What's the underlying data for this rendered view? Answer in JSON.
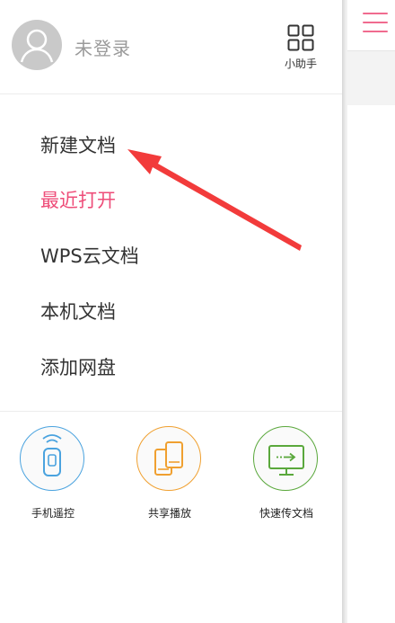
{
  "header": {
    "login_label": "未登录",
    "helper_label": "小助手"
  },
  "menu": {
    "items": [
      {
        "label": "新建文档",
        "active": false
      },
      {
        "label": "最近打开",
        "active": true
      },
      {
        "label": "WPS云文档",
        "active": false
      },
      {
        "label": "本机文档",
        "active": false
      },
      {
        "label": "添加网盘",
        "active": false
      }
    ]
  },
  "tools": [
    {
      "label": "手机遥控",
      "icon": "phone-remote-icon",
      "color": "#4aa3df"
    },
    {
      "label": "共享播放",
      "icon": "share-play-icon",
      "color": "#f0a030"
    },
    {
      "label": "快速传文档",
      "icon": "fast-transfer-icon",
      "color": "#5aa83c"
    }
  ],
  "colors": {
    "accent": "#ee4d79",
    "annotation_arrow": "#f23b3b"
  }
}
